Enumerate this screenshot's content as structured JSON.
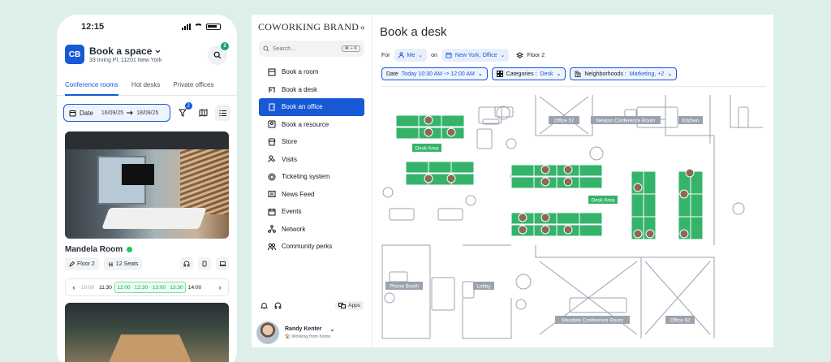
{
  "phone": {
    "status_time": "12:15",
    "brand_initials": "CB",
    "title": "Book a space",
    "address": "33 Irving Pl, 11201 New York",
    "search_badge": "2",
    "tabs": [
      "Conference rooms",
      "Hot desks",
      "Private offices"
    ],
    "date_label": "Date",
    "date_from": "16/09/25",
    "date_to": "18/09/25",
    "filter_badge": "2",
    "room": {
      "name": "Mandela Room",
      "floor": "Floor 2",
      "seats": "12 Seats",
      "times": [
        "10:00",
        "11:30",
        "12:00",
        "12:30",
        "13:00",
        "13:30",
        "14:00"
      ]
    }
  },
  "desktop": {
    "brand": "COWORKING BRAND",
    "search_placeholder": "Search...",
    "search_shortcut": "⌘ + K",
    "menu": [
      "Book a room",
      "Book a desk",
      "Book an office",
      "Book a resource",
      "Store",
      "Visits",
      "Ticketing system",
      "News Feed",
      "Events",
      "Network",
      "Community perks"
    ],
    "apps_label": "Apps",
    "user_name": "Randy Kenter",
    "user_status": "Working from home",
    "page_title": "Book a desk",
    "for_label": "For",
    "for_value": "Me",
    "on_label": "on",
    "on_value": "New York, Office",
    "floor": "Floor 2",
    "date_filter_label": "Date",
    "date_filter_value": "Today 10:30 AM -> 12:00 AM",
    "categories_label": "Categories :",
    "categories_value": "Desk",
    "neighborhoods_label": "Neighborhoods :",
    "neighborhoods_value": "Marketing, +2",
    "plan_labels": {
      "desk_area_1": "Desk Area",
      "desk_area_2": "Desk Area",
      "office_57": "Office 57",
      "newton": "Newton Conference Room",
      "kitchen": "Kitchen",
      "phone_booth": "Phone Booth",
      "lobby": "Lobby",
      "mandela": "Mandela Conference Room",
      "office_62": "Office 62"
    }
  },
  "colors": {
    "brand_blue": "#1859d6",
    "desk_green": "#36b36b",
    "background": "#dcefeb"
  }
}
